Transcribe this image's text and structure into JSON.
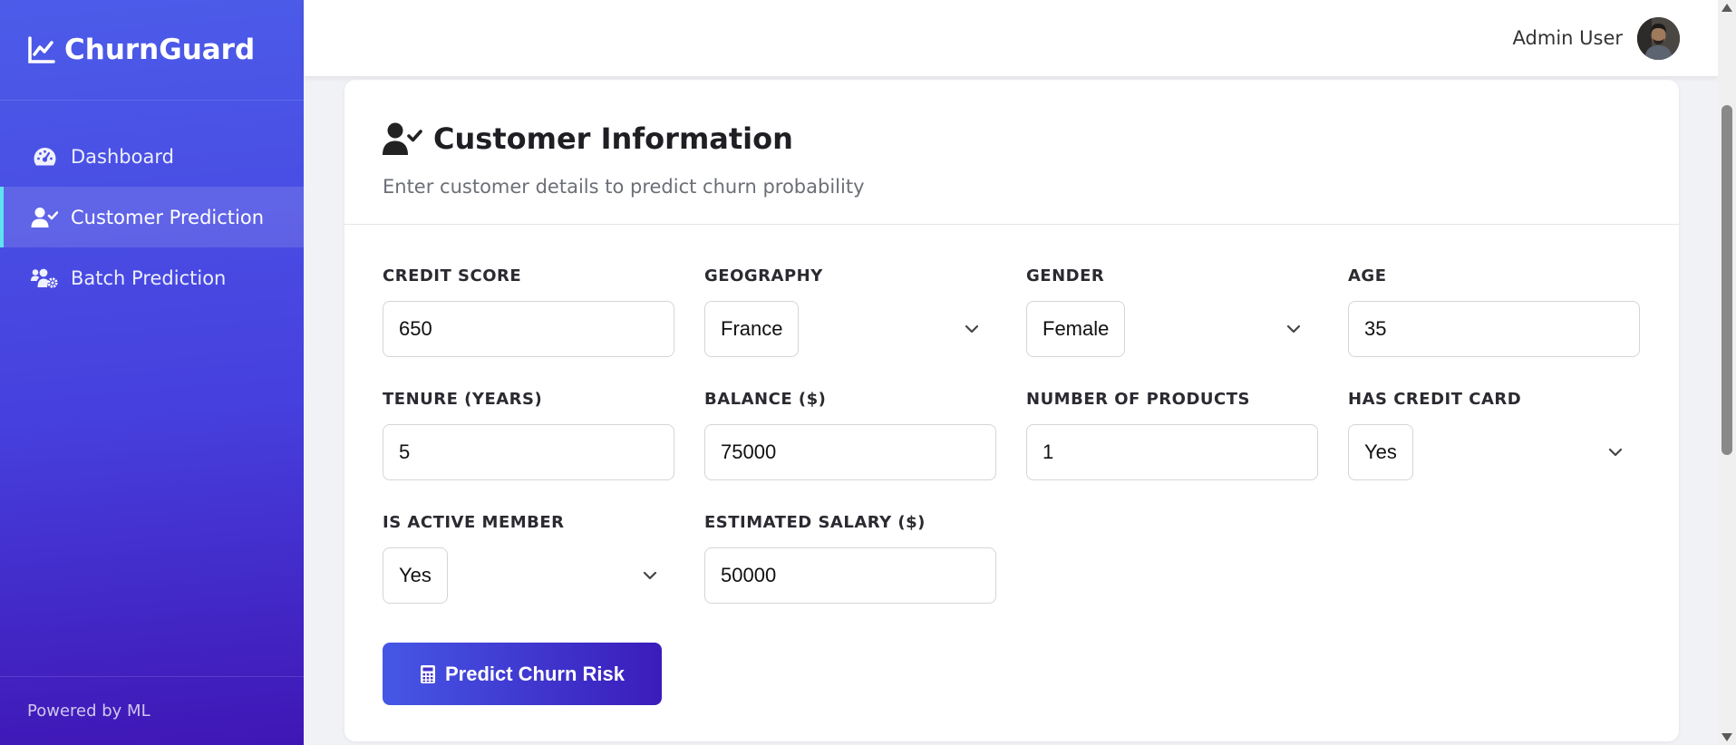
{
  "app": {
    "name": "ChurnGuard",
    "footer": "Powered by ML"
  },
  "sidebar": {
    "items": [
      {
        "label": "Dashboard",
        "icon": "gauge-icon",
        "active": false
      },
      {
        "label": "Customer Prediction",
        "icon": "user-check-icon",
        "active": true
      },
      {
        "label": "Batch Prediction",
        "icon": "users-gear-icon",
        "active": false
      }
    ]
  },
  "header": {
    "user_name": "Admin User"
  },
  "card": {
    "title": "Customer Information",
    "subtitle": "Enter customer details to predict churn probability"
  },
  "form": {
    "credit_score": {
      "label": "CREDIT SCORE",
      "value": "650"
    },
    "geography": {
      "label": "GEOGRAPHY",
      "value": "France"
    },
    "gender": {
      "label": "GENDER",
      "value": "Female"
    },
    "age": {
      "label": "AGE",
      "value": "35"
    },
    "tenure": {
      "label": "TENURE (YEARS)",
      "value": "5"
    },
    "balance": {
      "label": "BALANCE ($)",
      "value": "75000"
    },
    "num_products": {
      "label": "NUMBER OF PRODUCTS",
      "value": "1"
    },
    "has_credit_card": {
      "label": "HAS CREDIT CARD",
      "value": "Yes"
    },
    "is_active_member": {
      "label": "IS ACTIVE MEMBER",
      "value": "Yes"
    },
    "estimated_salary": {
      "label": "ESTIMATED SALARY ($)",
      "value": "50000"
    }
  },
  "actions": {
    "predict_label": "Predict Churn Risk"
  },
  "colors": {
    "sidebar_top": "#4c5ce9",
    "sidebar_bottom": "#3f16b5",
    "active_indicator": "#5fe3ee",
    "button_start": "#4557e6",
    "button_end": "#3b1cbb"
  }
}
